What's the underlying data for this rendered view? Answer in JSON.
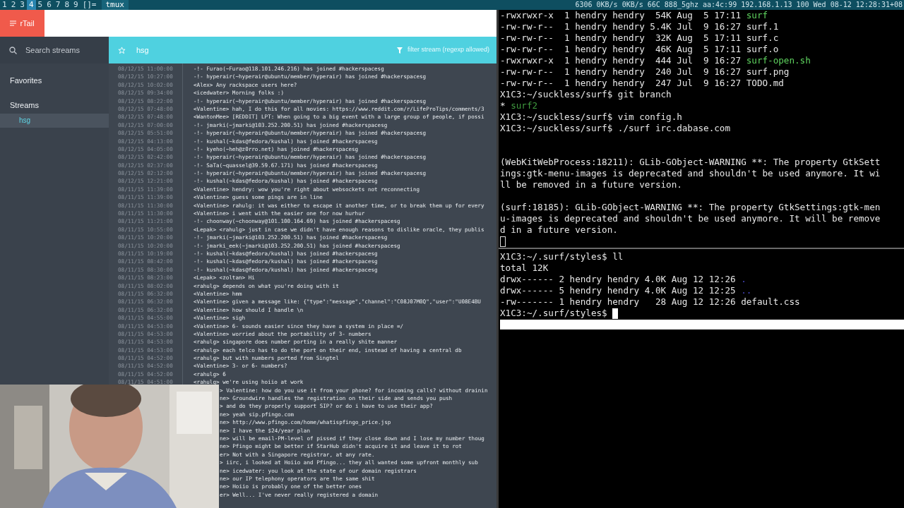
{
  "top_bar": {
    "workspaces": [
      {
        "label": "1",
        "selected": false
      },
      {
        "label": "2",
        "selected": false
      },
      {
        "label": "3",
        "selected": false
      },
      {
        "label": "4",
        "selected": true
      },
      {
        "label": "5",
        "selected": false
      },
      {
        "label": "6",
        "selected": false
      },
      {
        "label": "7",
        "selected": false
      },
      {
        "label": "8",
        "selected": false
      },
      {
        "label": "9",
        "selected": false
      }
    ],
    "layout": "[]=",
    "title": "tmux",
    "status": "6306 0KB/s 0KB/s 66C 888_5ghz aa:4c:99 192.168.1.13 100 Wed 08-12 12:28:31+08"
  },
  "browser": {
    "logo": "rTail",
    "search": {
      "placeholder": "Search streams"
    },
    "stream": "hsg",
    "filter": {
      "placeholder": "filter stream (regexp allowed)"
    },
    "sidebar": [
      {
        "kind": "heading",
        "label": "Favorites",
        "selected": false
      },
      {
        "kind": "heading",
        "label": "Streams",
        "selected": false
      },
      {
        "kind": "item",
        "label": "hsg",
        "selected": true
      }
    ],
    "log": [
      {
        "time": "08/12/15 11:00:00",
        "message": "-!- Furao(~Furao@118.101.246.216) has joined #hackerspacesg"
      },
      {
        "time": "08/12/15 10:27:00",
        "message": "-!- hyperair(~hyperair@ubuntu/member/hyperair) has joined #hackerspacesg"
      },
      {
        "time": "08/12/15 10:02:00",
        "message": "<Alex> Any rackspace users here?"
      },
      {
        "time": "08/12/15 09:34:00",
        "message": "<icedwater> Morning folks :)"
      },
      {
        "time": "08/12/15 08:22:00",
        "message": "-!- hyperair(~hyperair@ubuntu/member/hyperair) has joined #hackerspacesg"
      },
      {
        "time": "08/12/15 07:48:00",
        "message": "<Valentine> hah, I do this for all movies: https://www.reddit.com/r/LifeProTips/comments/3"
      },
      {
        "time": "08/12/15 07:48:00",
        "message": "<WantonMee> [REDDIT] LPT: When going to a big event with a large group of people, if possi"
      },
      {
        "time": "08/12/15 07:00:00",
        "message": "-!- jmarki(~jmarki@103.252.200.51) has joined #hackerspacesg"
      },
      {
        "time": "08/12/15 05:51:00",
        "message": "-!- hyperair(~hyperair@ubuntu/member/hyperair) has joined #hackerspacesg"
      },
      {
        "time": "08/12/15 04:13:00",
        "message": "-!- kushal(~kdas@fedora/kushal) has joined #hackerspacesg"
      },
      {
        "time": "08/12/15 04:05:00",
        "message": "-!- kyeho(~heh@z0rro.net) has joined #hackerspacesg"
      },
      {
        "time": "08/12/15 02:42:00",
        "message": "-!- hyperair(~hyperair@ubuntu/member/hyperair) has joined #hackerspacesg"
      },
      {
        "time": "08/12/15 02:37:00",
        "message": "-!- SaTa(~quassel@39.59.67.171) has joined #hackerspacesg"
      },
      {
        "time": "08/12/15 02:12:00",
        "message": "-!- hyperair(~hyperair@ubuntu/member/hyperair) has joined #hackerspacesg"
      },
      {
        "time": "08/12/15 12:21:00",
        "message": "-!- kushal(~kdas@fedora/kushal) has joined #hackerspacesg"
      },
      {
        "time": "08/11/15 11:39:00",
        "message": "<Valentine> hendry: wow you're right about websockets not reconnecting"
      },
      {
        "time": "08/11/15 11:39:00",
        "message": "<Valentine> guess some pings are in line"
      },
      {
        "time": "08/11/15 11:30:00",
        "message": "<Valentine> rahulg: it was either to escape it another time, or to break them up for every"
      },
      {
        "time": "08/11/15 11:30:00",
        "message": "<Valentine> i went with the easier one for now hurhur"
      },
      {
        "time": "08/11/15 11:21:00",
        "message": "-!- choonway(~choonway@101.100.164.69) has joined #hackerspacesg"
      },
      {
        "time": "08/11/15 10:55:00",
        "message": "<Lepak> <rahulg> just in case we didn't have enough reasons to dislike oracle, they publis"
      },
      {
        "time": "08/11/15 10:20:00",
        "message": "-!- jmarki(~jmarki@103.252.200.51) has joined #hackerspacesg"
      },
      {
        "time": "08/11/15 10:20:00",
        "message": "-!- jmarki_eek(~jmarki@103.252.200.51) has joined #hackerspacesg"
      },
      {
        "time": "08/11/15 10:19:00",
        "message": "-!- kushal(~kdas@fedora/kushal) has joined #hackerspacesg"
      },
      {
        "time": "08/11/15 08:42:00",
        "message": "-!- kushal(~kdas@fedora/kushal) has joined #hackerspacesg"
      },
      {
        "time": "08/11/15 08:30:00",
        "message": "-!- kushal(~kdas@fedora/kushal) has joined #hackerspacesg"
      },
      {
        "time": "08/11/15 08:23:00",
        "message": "<Lepak> <zoltan> Hi"
      },
      {
        "time": "08/11/15 08:02:00",
        "message": "<rahulg> depends on what you're doing with it"
      },
      {
        "time": "08/11/15 06:32:00",
        "message": "<Valentine> hmm"
      },
      {
        "time": "08/11/15 06:32:00",
        "message": "<Valentine> given a message like: {\"type\":\"message\",\"channel\":\"C08J07M0Q\",\"user\":\"U08E4BU"
      },
      {
        "time": "08/11/15 06:32:00",
        "message": "<Valentine> how should I handle \\n"
      },
      {
        "time": "08/11/15 04:55:00",
        "message": "<Valentine> sigh"
      },
      {
        "time": "08/11/15 04:53:00",
        "message": "<Valentine> 6- sounds easier since they have a system in place =/"
      },
      {
        "time": "08/11/15 04:53:00",
        "message": "<Valentine> worried about the portability of 3- numbers"
      },
      {
        "time": "08/11/15 04:53:00",
        "message": "<rahulg> singapore does number porting in a really shite manner"
      },
      {
        "time": "08/11/15 04:53:00",
        "message": "<rahulg> each telco has to do the port on their end, instead of having a central db"
      },
      {
        "time": "08/11/15 04:52:00",
        "message": "<rahulg> but with numbers ported from Singtel"
      },
      {
        "time": "08/11/15 04:52:00",
        "message": "<Valentine> 3- or 6- numbers?"
      },
      {
        "time": "08/11/15 04:52:00",
        "message": "<rahulg> 6"
      },
      {
        "time": "08/11/15 04:51:00",
        "message": "<rahulg> we're using hoiio at work"
      }
    ],
    "log_partial": [
      "> Valentine: how do you use it from your phone? for incoming calls? without drainin",
      "ne> Groundwire handles the registration on their side and sends you push",
      "> and do they properly support SIP? or do i have to use their app?",
      "ne> yeah sip.pfingo.com",
      "ne> http://www.pfingo.com/home/whatispfingo_price.jsp",
      "ne> I have the $24/year plan",
      "ne> will be email-PM-level of pissed if they close down and I lose my number thoug",
      "ne> Pfingo might be better if StarHub didn't acquire it and leave it to rot",
      "er> Not with a Singapore registrar, at any rate.",
      "> iirc, i looked at Hoiio and Pfingo... they all wanted some upfront monthly sub",
      "ne> icedwater: you look at the state of our domain registrars",
      "ne> our IP telephony operators are the same shit",
      "ne> Hoiio is probably one of the better ones",
      "er> Well... I've never really registered a domain"
    ]
  },
  "terminal": {
    "top_pane": [
      {
        "kind": "text",
        "segments": [
          {
            "kind": "plain",
            "text": "-rwxrwxr-x  1 hendry hendry  54K Aug  5 17:11 "
          },
          {
            "kind": "exec",
            "text": "surf"
          }
        ]
      },
      {
        "kind": "text",
        "segments": [
          {
            "kind": "plain",
            "text": "-rw-rw-r--  1 hendry hendry 5.4K Jul  9 16:27 surf.1"
          }
        ]
      },
      {
        "kind": "text",
        "segments": [
          {
            "kind": "plain",
            "text": "-rw-rw-r--  1 hendry hendry  32K Aug  5 17:11 surf.c"
          }
        ]
      },
      {
        "kind": "text",
        "segments": [
          {
            "kind": "plain",
            "text": "-rw-rw-r--  1 hendry hendry  46K Aug  5 17:11 surf.o"
          }
        ]
      },
      {
        "kind": "text",
        "segments": [
          {
            "kind": "plain",
            "text": "-rwxrwxr-x  1 hendry hendry  444 Jul  9 16:27 "
          },
          {
            "kind": "exec",
            "text": "surf-open.sh"
          }
        ]
      },
      {
        "kind": "text",
        "segments": [
          {
            "kind": "plain",
            "text": "-rw-rw-r--  1 hendry hendry  240 Jul  9 16:27 surf.png"
          }
        ]
      },
      {
        "kind": "text",
        "segments": [
          {
            "kind": "plain",
            "text": "-rw-rw-r--  1 hendry hendry  247 Jul  9 16:27 TODO.md"
          }
        ]
      },
      {
        "kind": "text",
        "segments": [
          {
            "kind": "plain",
            "text": "X1C3:~/suckless/surf$ git branch"
          }
        ]
      },
      {
        "kind": "text",
        "segments": [
          {
            "kind": "plain",
            "text": "* "
          },
          {
            "kind": "branch",
            "text": "surf2"
          }
        ]
      },
      {
        "kind": "text",
        "segments": [
          {
            "kind": "plain",
            "text": "X1C3:~/suckless/surf$ vim config.h"
          }
        ]
      },
      {
        "kind": "text",
        "segments": [
          {
            "kind": "plain",
            "text": "X1C3:~/suckless/surf$ ./surf irc.dabase.com"
          }
        ]
      },
      {
        "kind": "blank"
      },
      {
        "kind": "blank"
      },
      {
        "kind": "text",
        "segments": [
          {
            "kind": "plain",
            "text": "(WebKitWebProcess:18211): GLib-GObject-WARNING **: The property GtkSett"
          }
        ]
      },
      {
        "kind": "text",
        "segments": [
          {
            "kind": "plain",
            "text": "ings:gtk-menu-images is deprecated and shouldn't be used anymore. It wi"
          }
        ]
      },
      {
        "kind": "text",
        "segments": [
          {
            "kind": "plain",
            "text": "ll be removed in a future version."
          }
        ]
      },
      {
        "kind": "blank"
      },
      {
        "kind": "text",
        "segments": [
          {
            "kind": "plain",
            "text": "(surf:18185): GLib-GObject-WARNING **: The property GtkSettings:gtk-men"
          }
        ]
      },
      {
        "kind": "text",
        "segments": [
          {
            "kind": "plain",
            "text": "u-images is deprecated and shouldn't be used anymore. It will be remove"
          }
        ]
      },
      {
        "kind": "text",
        "segments": [
          {
            "kind": "plain",
            "text": "d in a future version."
          }
        ]
      },
      {
        "kind": "cursor",
        "active": false
      }
    ],
    "bottom_pane": [
      {
        "kind": "text",
        "segments": [
          {
            "kind": "plain",
            "text": "X1C3:~/.surf/styles$ ll"
          }
        ]
      },
      {
        "kind": "text",
        "segments": [
          {
            "kind": "plain",
            "text": "total 12K"
          }
        ]
      },
      {
        "kind": "text",
        "segments": [
          {
            "kind": "plain",
            "text": "drwx------ 2 hendry hendry 4.0K Aug 12 12:26 "
          },
          {
            "kind": "dir",
            "text": "."
          }
        ]
      },
      {
        "kind": "text",
        "segments": [
          {
            "kind": "plain",
            "text": "drwx------ 5 hendry hendry 4.0K Aug 12 12:25 "
          },
          {
            "kind": "dir",
            "text": ".."
          }
        ]
      },
      {
        "kind": "text",
        "segments": [
          {
            "kind": "plain",
            "text": "-rw------- 1 hendry hendry   28 Aug 12 12:26 default.css"
          }
        ]
      },
      {
        "kind": "prompt",
        "text": "X1C3:~/.surf/styles$ ",
        "active": true
      }
    ]
  }
}
